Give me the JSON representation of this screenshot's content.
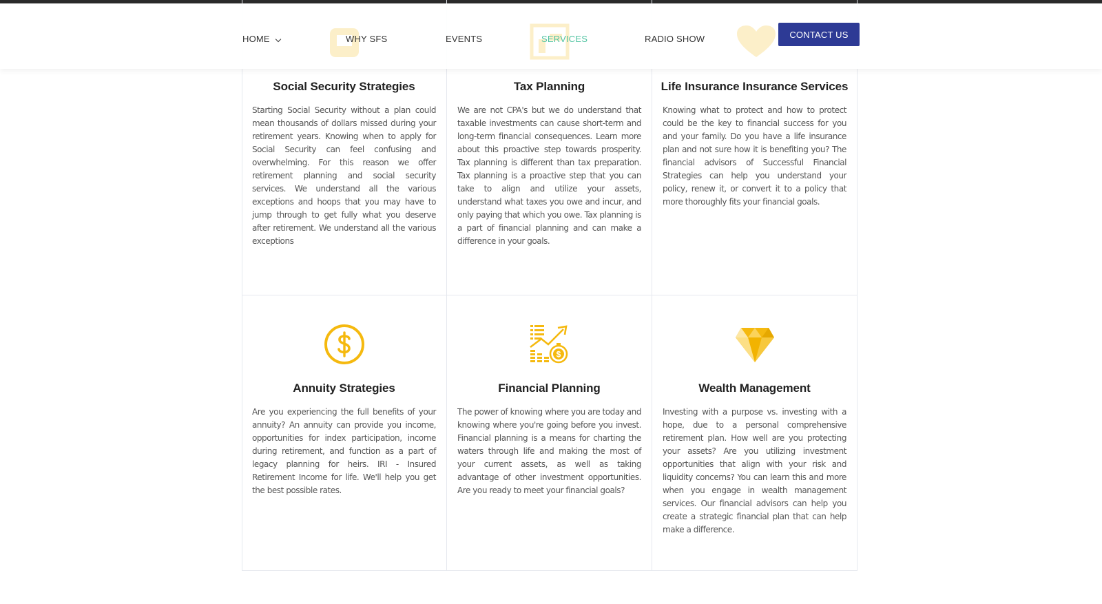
{
  "nav": {
    "items": [
      {
        "label": "HOME"
      },
      {
        "label": "WHY SFS"
      },
      {
        "label": "EVENTS"
      },
      {
        "label": "SERVICES"
      },
      {
        "label": "RADIO SHOW"
      }
    ],
    "active": "SERVICES",
    "cta_label": "CONTACT US"
  },
  "colors": {
    "accent_blue": "#2d3a95",
    "active_nav": "#4fc3a1",
    "icon_gold": "#f5b90f"
  },
  "services": [
    {
      "title": "Social Security Strategies",
      "text": "Starting Social Security without a plan could mean thousands of dollars missed during your retirement years. Knowing when to apply for Social Security can feel confusing and overwhelming. For this reason we offer retirement planning and social security services. We understand all the various exceptions and hoops that you may have to jump through to get fully what you deserve after retirement. We understand all the various exceptions"
    },
    {
      "title": "Tax Planning",
      "text": "We are not CPA's but we do understand that taxable investments can cause short-term and long-term financial consequences. Learn more about this proactive step towards prosperity. Tax planning is different than tax preparation. Tax planning is a proactive step that you can take to align and utilize your assets, understand what taxes you owe and incur, and only paying that which you owe. Tax planning is a part of financial planning and can make a difference in your goals."
    },
    {
      "title": "Life Insurance Insurance Services",
      "text": "Knowing what to protect and how to protect could be the key to financial success for you and your family. Do you have a life insurance plan and not sure how it is benefiting you? The financial advisors of Successful Financial Strategies can help you understand your policy, renew it, or convert it to a policy that more thoroughly fits your financial goals."
    },
    {
      "title": "Annuity Strategies",
      "icon": "dollar-coin-icon",
      "text": "Are you experiencing the full benefits of your annuity? An annuity can provide you income, opportunities for index participation, income during retirement, and function as a part of legacy planning for heirs. IRI - Insured Retirement Income for life. We'll help you get the best possible rates."
    },
    {
      "title": "Financial Planning",
      "icon": "growth-chart-icon",
      "text": "The power of knowing where you are today and knowing where you're going before you invest. Financial planning is a means for charting the waters through life and making the most of your current assets, as well as taking advantage of other investment opportunities. Are you ready to meet your financial goals?"
    },
    {
      "title": "Wealth Management",
      "icon": "diamond-icon",
      "text": "Investing with a purpose vs. investing with a hope, due to a personal comprehensive retirement plan. How well are you protecting your assets? Are you utilizing investment opportunities that align with your risk and liquidity concerns? You can learn this and more when you engage in wealth management services. Our financial advisors can help you create a strategic financial plan that can help make a difference."
    }
  ]
}
